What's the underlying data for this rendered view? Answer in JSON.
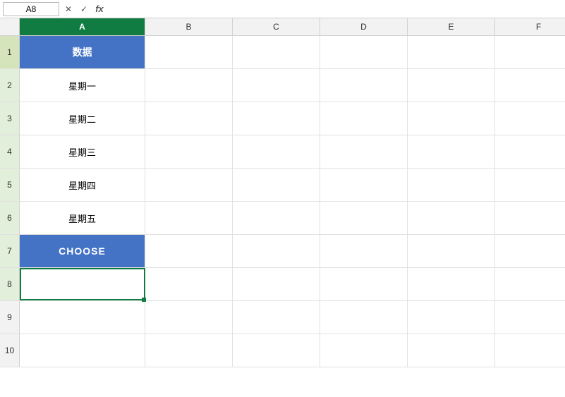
{
  "formula_bar": {
    "cell_ref": "A8",
    "cancel_label": "✕",
    "confirm_label": "✓",
    "fx_label": "fx",
    "formula_value": ""
  },
  "columns": [
    {
      "id": "A",
      "label": "A",
      "width": "col-a",
      "active": true
    },
    {
      "id": "B",
      "label": "B",
      "width": "col-b",
      "active": false
    },
    {
      "id": "C",
      "label": "C",
      "width": "col-c",
      "active": false
    },
    {
      "id": "D",
      "label": "D",
      "width": "col-d",
      "active": false
    },
    {
      "id": "E",
      "label": "E",
      "width": "col-e",
      "active": false
    },
    {
      "id": "F",
      "label": "F",
      "width": "col-f",
      "active": false
    }
  ],
  "rows": [
    {
      "num": "1",
      "cells": [
        {
          "text": "数据",
          "style": "header-blue"
        },
        {
          "text": "",
          "style": "white"
        },
        {
          "text": "",
          "style": "white"
        },
        {
          "text": "",
          "style": "white"
        },
        {
          "text": "",
          "style": "white"
        },
        {
          "text": "",
          "style": "white"
        }
      ]
    },
    {
      "num": "2",
      "cells": [
        {
          "text": "星期一",
          "style": "white"
        },
        {
          "text": "",
          "style": "white"
        },
        {
          "text": "",
          "style": "white"
        },
        {
          "text": "",
          "style": "white"
        },
        {
          "text": "",
          "style": "white"
        },
        {
          "text": "",
          "style": "white"
        }
      ]
    },
    {
      "num": "3",
      "cells": [
        {
          "text": "星期二",
          "style": "white"
        },
        {
          "text": "",
          "style": "white"
        },
        {
          "text": "",
          "style": "white"
        },
        {
          "text": "",
          "style": "white"
        },
        {
          "text": "",
          "style": "white"
        },
        {
          "text": "",
          "style": "white"
        }
      ]
    },
    {
      "num": "4",
      "cells": [
        {
          "text": "星期三",
          "style": "white"
        },
        {
          "text": "",
          "style": "white"
        },
        {
          "text": "",
          "style": "white"
        },
        {
          "text": "",
          "style": "white"
        },
        {
          "text": "",
          "style": "white"
        },
        {
          "text": "",
          "style": "white"
        }
      ]
    },
    {
      "num": "5",
      "cells": [
        {
          "text": "星期四",
          "style": "white"
        },
        {
          "text": "",
          "style": "white"
        },
        {
          "text": "",
          "style": "white"
        },
        {
          "text": "",
          "style": "white"
        },
        {
          "text": "",
          "style": "white"
        },
        {
          "text": "",
          "style": "white"
        }
      ]
    },
    {
      "num": "6",
      "cells": [
        {
          "text": "星期五",
          "style": "white"
        },
        {
          "text": "",
          "style": "white"
        },
        {
          "text": "",
          "style": "white"
        },
        {
          "text": "",
          "style": "white"
        },
        {
          "text": "",
          "style": "white"
        },
        {
          "text": "",
          "style": "white"
        }
      ]
    },
    {
      "num": "7",
      "cells": [
        {
          "text": "CHOOSE",
          "style": "choose-blue"
        },
        {
          "text": "",
          "style": "white"
        },
        {
          "text": "",
          "style": "white"
        },
        {
          "text": "",
          "style": "white"
        },
        {
          "text": "",
          "style": "white"
        },
        {
          "text": "",
          "style": "white"
        }
      ]
    },
    {
      "num": "8",
      "cells": [
        {
          "text": "",
          "style": "selected"
        },
        {
          "text": "",
          "style": "white"
        },
        {
          "text": "",
          "style": "white"
        },
        {
          "text": "",
          "style": "white"
        },
        {
          "text": "",
          "style": "white"
        },
        {
          "text": "",
          "style": "white"
        }
      ]
    },
    {
      "num": "9",
      "cells": [
        {
          "text": "",
          "style": "white"
        },
        {
          "text": "",
          "style": "white"
        },
        {
          "text": "",
          "style": "white"
        },
        {
          "text": "",
          "style": "white"
        },
        {
          "text": "",
          "style": "white"
        },
        {
          "text": "",
          "style": "white"
        }
      ]
    },
    {
      "num": "10",
      "cells": [
        {
          "text": "",
          "style": "white"
        },
        {
          "text": "",
          "style": "white"
        },
        {
          "text": "",
          "style": "white"
        },
        {
          "text": "",
          "style": "white"
        },
        {
          "text": "",
          "style": "white"
        },
        {
          "text": "",
          "style": "white"
        }
      ]
    }
  ]
}
